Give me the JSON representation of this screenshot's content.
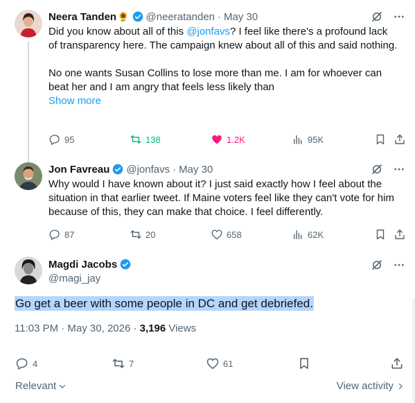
{
  "colors": {
    "link": "#1d9bf0",
    "verified": "#1d9bf0",
    "muted": "#536471",
    "retweet": "#00ba7c",
    "like": "#f91880",
    "selection": "#b4d5fe"
  },
  "tweets": [
    {
      "name": "Neera Tanden",
      "name_emoji": "🌻",
      "handle": "@neeratanden",
      "sep": "·",
      "date": "May 30",
      "body_pre": "Did you know about all of this ",
      "body_mention": "@jonfavs",
      "body_post": "?  I feel like there's a profound lack of transparency here. The campaign knew about all of this and said nothing.",
      "body_para2": "No one wants Susan Collins to lose more than me.  I am for whoever can beat her and I am angry that feels less likely than",
      "show_more": "Show more",
      "replies": "95",
      "retweets": "138",
      "likes": "1.2K",
      "views": "95K"
    },
    {
      "name": "Jon Favreau",
      "handle": "@jonfavs",
      "sep": "·",
      "date": "May 30",
      "body": "Why would I have known about it? I just said exactly how I feel about the situation in that earlier tweet. If Maine voters feel like they can't vote for him because of this, they can make that choice. I feel differently.",
      "replies": "87",
      "retweets": "20",
      "likes": "658",
      "views": "62K"
    }
  ],
  "focus": {
    "name": "Magdi Jacobs",
    "handle": "@magi_jay",
    "text": "Go get a beer with some people in DC and get debriefed.",
    "time": "11:03 PM · May 30, 2026 · ",
    "views_count": "3,196",
    "views_label": " Views",
    "replies": "4",
    "retweets": "7",
    "likes": "61"
  },
  "footer": {
    "sort_label": "Relevant",
    "view_activity": "View activity"
  },
  "icons": [
    "verified-badge-icon",
    "grok-icon",
    "more-icon",
    "reply-icon",
    "retweet-icon",
    "like-icon",
    "views-icon",
    "bookmark-icon",
    "share-icon",
    "chevron-down-icon",
    "chevron-right-icon"
  ]
}
